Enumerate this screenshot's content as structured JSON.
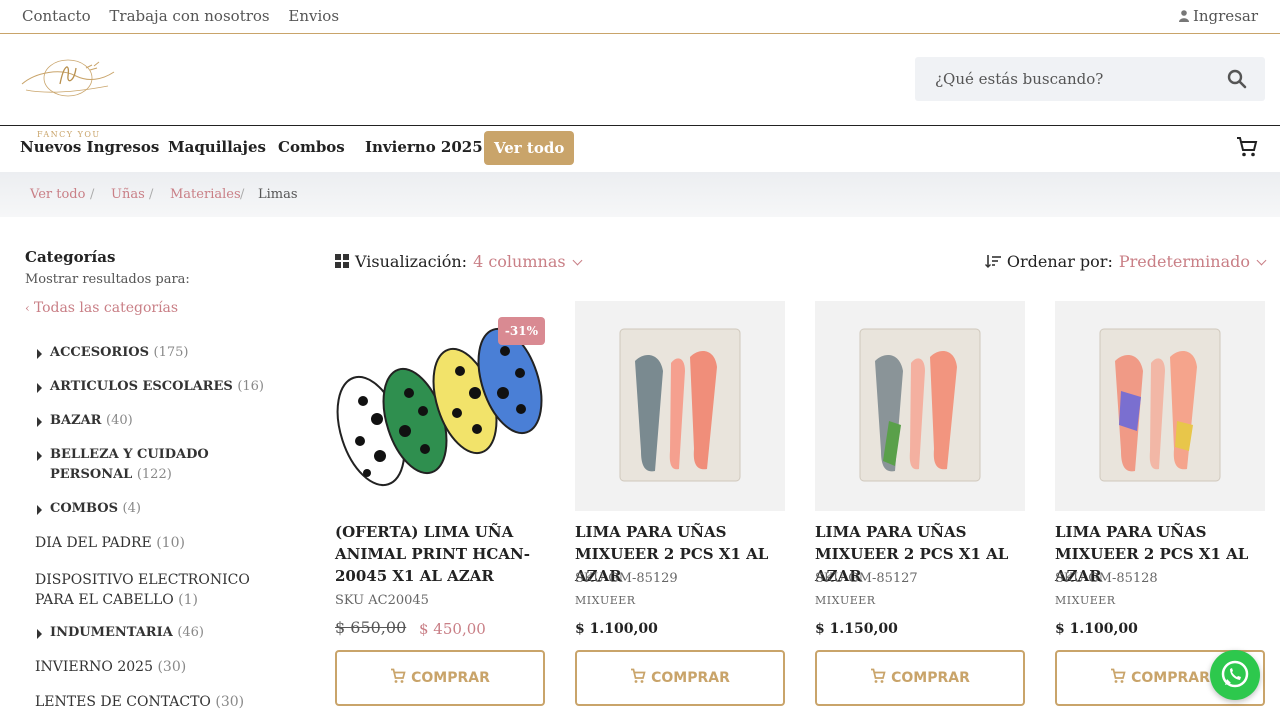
{
  "topbar": {
    "links": [
      "Contacto",
      "Trabaja con nosotros",
      "Envios"
    ],
    "login": "Ingresar"
  },
  "brand": {
    "logo_text": "FANCY YOU"
  },
  "search": {
    "placeholder": "¿Qué estás buscando?"
  },
  "nav": {
    "items": [
      "Nuevos Ingresos",
      "Maquillajes",
      "Combos",
      "Invierno 2025"
    ],
    "cta": "Ver todo"
  },
  "breadcrumb": [
    "Ver todo",
    "Uñas",
    "Materiales",
    "Limas"
  ],
  "sidebar": {
    "title": "Categorías",
    "subtitle": "Mostrar resultados para:",
    "all_label": "Todas las categorías",
    "categories": [
      {
        "name": "ACCESORIOS",
        "count": "(175)"
      },
      {
        "name": "ARTICULOS ESCOLARES",
        "count": "(16)"
      },
      {
        "name": "BAZAR",
        "count": "(40)"
      },
      {
        "name": "BELLEZA Y CUIDADO PERSONAL",
        "count": "(122)"
      },
      {
        "name": "COMBOS",
        "count": "(4)"
      },
      {
        "name": "DIA DEL PADRE",
        "count": "(10)"
      },
      {
        "name": "DISPOSITIVO ELECTRONICO PARA EL CABELLO",
        "count": "(1)"
      },
      {
        "name": "INDUMENTARIA",
        "count": "(46)"
      },
      {
        "name": "INVIERNO 2025",
        "count": "(30)"
      },
      {
        "name": "LENTES DE CONTACTO",
        "count": "(30)"
      }
    ]
  },
  "toolbar": {
    "view_label": "Visualización:",
    "view_value": "4 columnas",
    "sort_label": "Ordenar por:",
    "sort_value": "Predeterminado"
  },
  "products": [
    {
      "name": "(OFERTA) LIMA UÑA ANIMAL PRINT HCAN-20045 X1 AL AZAR",
      "sku": "SKU AC20045",
      "badge": "-31%",
      "old_price": "$ 650,00",
      "price": "$ 450,00",
      "button": "COMPRAR"
    },
    {
      "name": "LIMA PARA UÑAS MIXUEER 2 PCS X1 AL AZAR",
      "sku": "SKU GM-85129",
      "brand": "MIXUEER",
      "price": "$ 1.100,00",
      "button": "COMPRAR"
    },
    {
      "name": "LIMA PARA UÑAS MIXUEER 2 PCS X1 AL AZAR",
      "sku": "SKU GM-85127",
      "brand": "MIXUEER",
      "price": "$ 1.150,00",
      "button": "COMPRAR"
    },
    {
      "name": "LIMA PARA UÑAS MIXUEER 2 PCS X1 AL AZAR",
      "sku": "SKU GM-85128",
      "brand": "MIXUEER",
      "price": "$ 1.100,00",
      "button": "COMPRAR"
    }
  ],
  "colors": {
    "accent": "#c9a46a",
    "link": "#c97f86",
    "whatsapp": "#2dc84d"
  },
  "icons": [
    "user-icon",
    "search-icon",
    "cart-icon",
    "grid-icon",
    "sort-icon",
    "whatsapp-icon"
  ]
}
